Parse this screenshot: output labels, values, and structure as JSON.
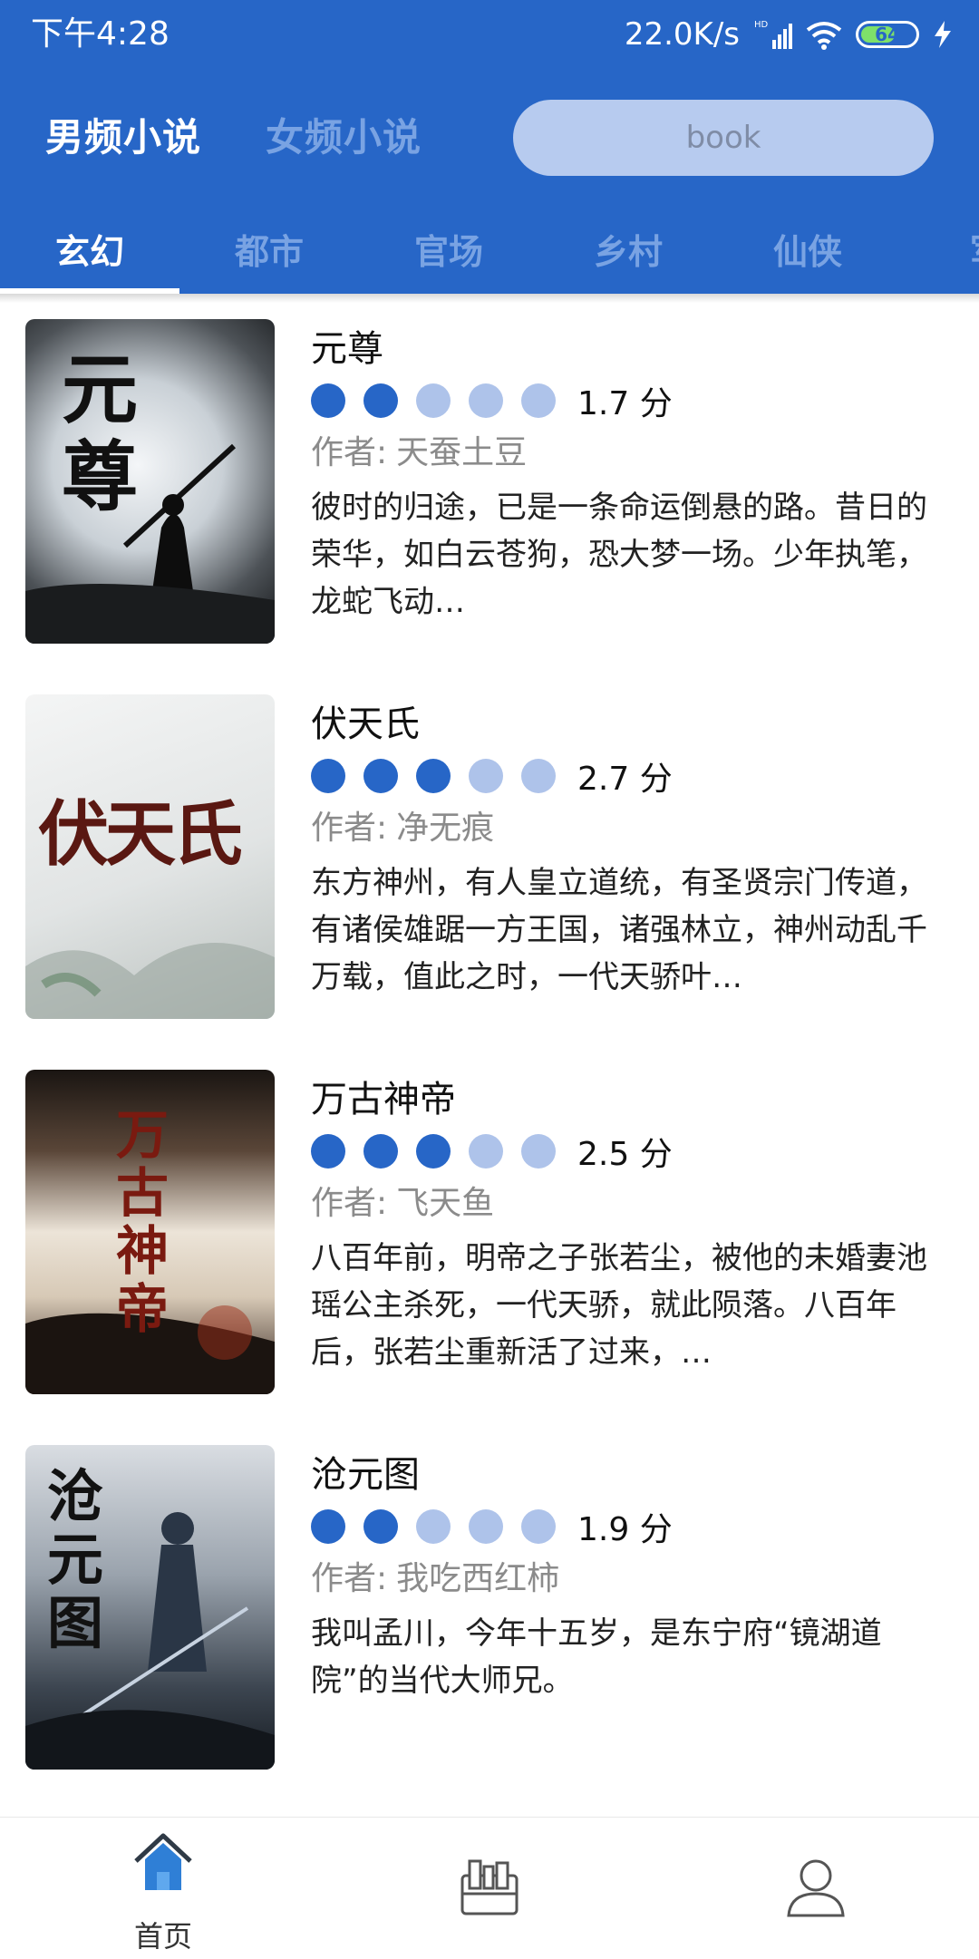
{
  "status_bar": {
    "time": "下午4:28",
    "net_speed": "22.0K/s",
    "battery": "64"
  },
  "header": {
    "tabs": [
      {
        "label": "男频小说",
        "active": true
      },
      {
        "label": "女频小说",
        "active": false
      }
    ],
    "search_placeholder": "book"
  },
  "categories": [
    {
      "label": "玄幻",
      "active": true
    },
    {
      "label": "都市",
      "active": false
    },
    {
      "label": "官场",
      "active": false
    },
    {
      "label": "乡村",
      "active": false
    },
    {
      "label": "仙侠",
      "active": false
    },
    {
      "label": "军",
      "active": false
    }
  ],
  "books": [
    {
      "title": "元尊",
      "rating_filled": 2,
      "rating_total": 5,
      "score": "1.7 分",
      "author_prefix": "作者:",
      "author": "天蚕土豆",
      "description": "彼时的归途，已是一条命运倒悬的路。昔日的荣华，如白云苍狗，恐大梦一场。少年执笔，龙蛇飞动…",
      "cover_text": "元尊"
    },
    {
      "title": "伏天氏",
      "rating_filled": 3,
      "rating_total": 5,
      "score": "2.7 分",
      "author_prefix": "作者:",
      "author": "净无痕",
      "description": "东方神州，有人皇立道统，有圣贤宗门传道，有诸侯雄踞一方王国，诸强林立，神州动乱千万载，值此之时，一代天骄叶…",
      "cover_text": "伏天氏"
    },
    {
      "title": "万古神帝",
      "rating_filled": 3,
      "rating_total": 5,
      "score": "2.5 分",
      "author_prefix": "作者:",
      "author": "飞天鱼",
      "description": "八百年前，明帝之子张若尘，被他的未婚妻池瑶公主杀死，一代天骄，就此陨落。八百年后，张若尘重新活了过来，…",
      "cover_text": "万古神帝"
    },
    {
      "title": "沧元图",
      "rating_filled": 2,
      "rating_total": 5,
      "score": "1.9 分",
      "author_prefix": "作者:",
      "author": "我吃西红柿",
      "description": "我叫孟川，今年十五岁，是东宁府“镜湖道院”的当代大师兄。",
      "cover_text": "沧元图"
    }
  ],
  "bottom_nav": [
    {
      "label": "首页",
      "icon": "home-icon",
      "active": true
    },
    {
      "label": "",
      "icon": "bookshelf-icon",
      "active": false
    },
    {
      "label": "",
      "icon": "profile-icon",
      "active": false
    }
  ],
  "colors": {
    "primary": "#2766c7",
    "inactive_tab": "#79a3e3",
    "rating_on": "#2766c7",
    "rating_off": "#aec3ea"
  }
}
